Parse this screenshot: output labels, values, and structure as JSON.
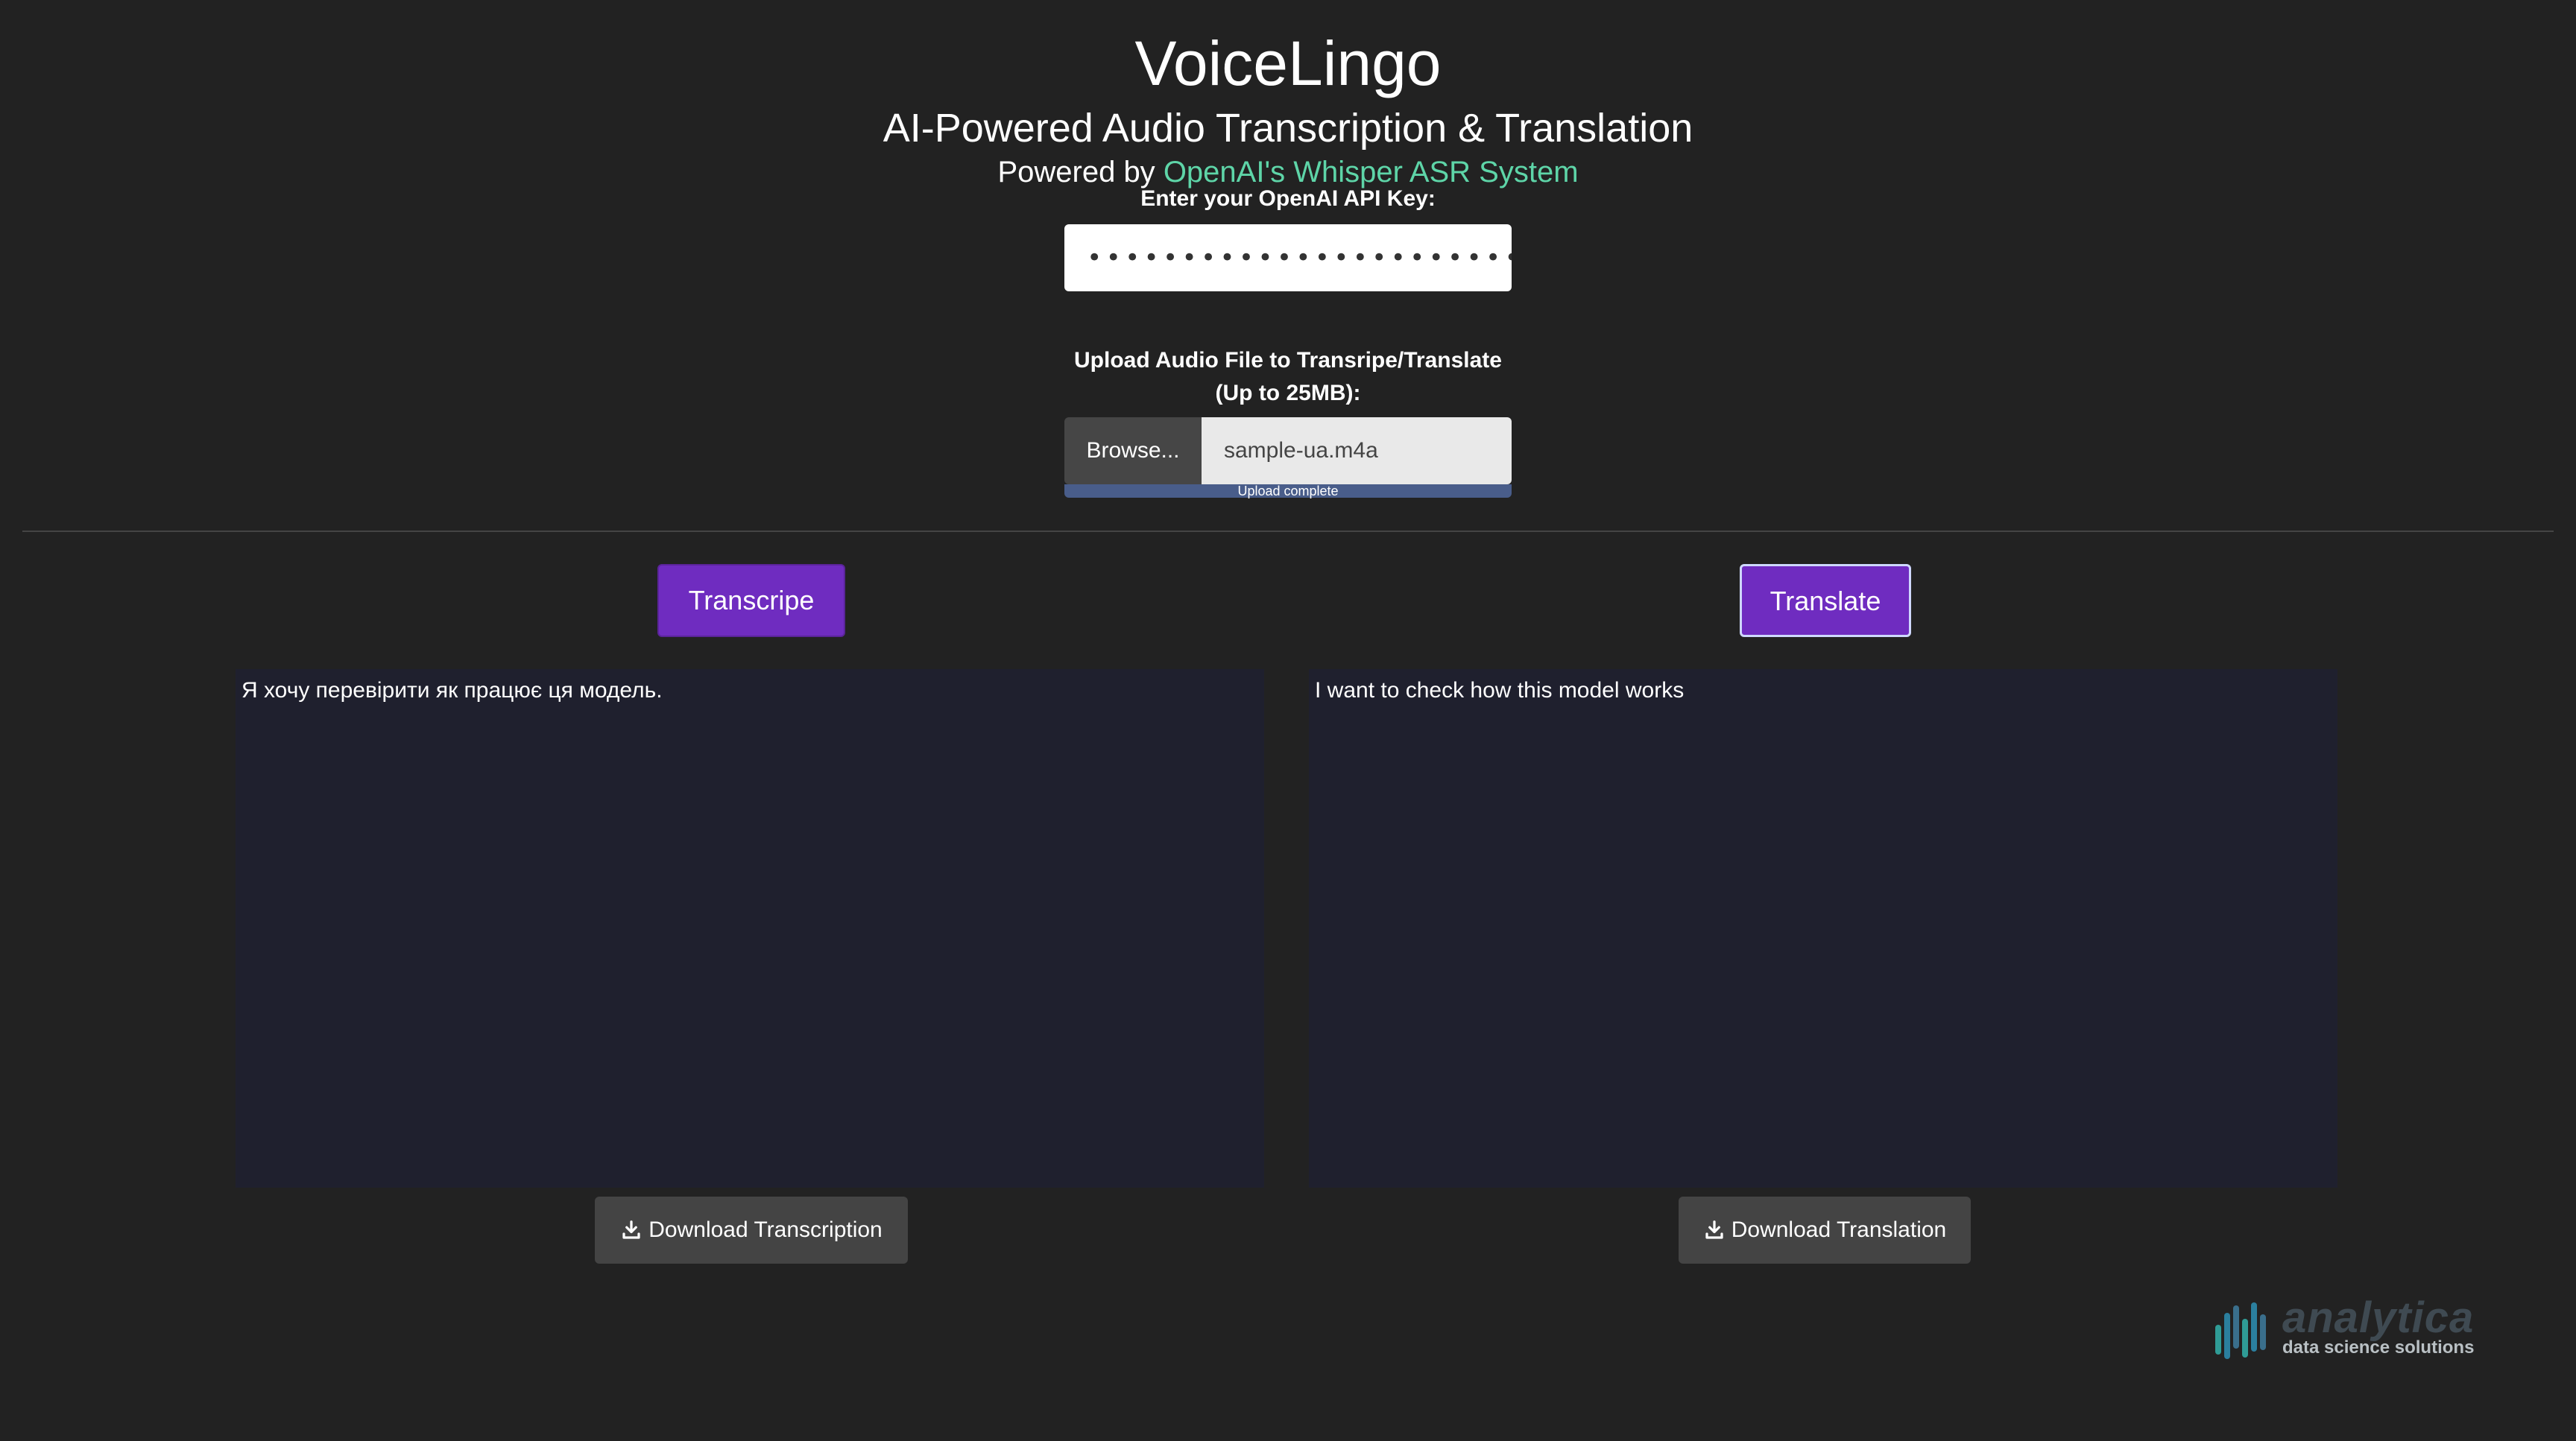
{
  "header": {
    "title": "VoiceLingo",
    "subtitle": "AI-Powered Audio Transcription & Translation",
    "powered_prefix": "Powered by",
    "powered_link": "OpenAI's Whisper ASR System"
  },
  "api_key": {
    "label": "Enter your OpenAI API Key:",
    "masked_value": "•••••••••••••••••••••••••••••"
  },
  "upload": {
    "label": "Upload Audio File to Transripe/Translate (Up to 25MB):",
    "browse_label": "Browse...",
    "file_name": "sample-ua.m4a",
    "progress_text": "Upload complete",
    "progress_fraction": 1.0
  },
  "actions": {
    "transcribe_label": "Transcripe",
    "translate_label": "Translate"
  },
  "outputs": {
    "transcription_text": "Я хочу перевірити як працює ця модель.",
    "translation_text": "I want to check how this model works"
  },
  "downloads": {
    "transcription_label": "Download Transcription",
    "translation_label": "Download Translation",
    "icon": "download-icon"
  },
  "logo": {
    "name": "analytica",
    "tagline": "data science solutions"
  },
  "colors": {
    "background": "#222222",
    "accent_purple": "#6f2cc0",
    "link_green": "#5ed5a8",
    "textarea_bg": "#1f202e",
    "button_gray": "#444444"
  }
}
